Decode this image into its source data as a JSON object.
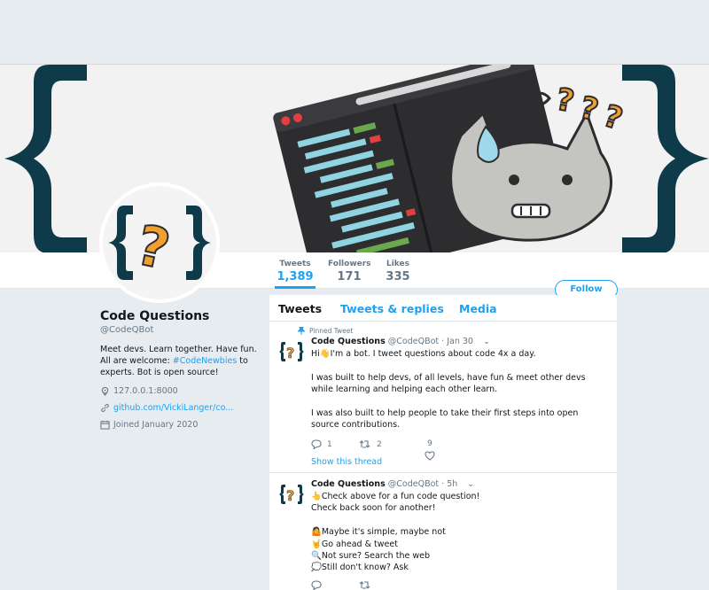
{
  "profile": {
    "name": "Code Questions",
    "handle": "@CodeQBot",
    "bio_prefix": "Meet devs. Learn together. Have fun. All are welcome: ",
    "bio_tag": "#CodeNewbies",
    "bio_suffix": " to experts. Bot is open source!",
    "location": "127.0.0.1:8000",
    "website": "github.com/VickiLanger/co...",
    "joined": "Joined January 2020"
  },
  "stats": [
    {
      "label": "Tweets",
      "value": "1,389"
    },
    {
      "label": "Followers",
      "value": "171"
    },
    {
      "label": "Likes",
      "value": "335"
    }
  ],
  "follow_label": "Follow",
  "tabs": [
    "Tweets",
    "Tweets & replies",
    "Media"
  ],
  "tweets": [
    {
      "pinned_label": "Pinned Tweet",
      "name": "Code Questions",
      "handle": "@CodeQBot",
      "time": "· Jan 30",
      "body": "Hi👋I'm a bot. I tweet questions about code 4x a day.\n\nI was built to help devs, of all levels, have fun & meet other devs while learning and helping each other learn.\n\nI was also built to help people to take their first steps into open source contributions.",
      "replies": "1",
      "retweets": "2",
      "likes": "9",
      "show_thread": "Show this thread"
    },
    {
      "name": "Code Questions",
      "handle": "@CodeQBot",
      "time": "· 5h",
      "body": "👆Check above for a fun code question!\nCheck back soon for another!\n\n🤷Maybe it's simple, maybe not\n🤘Go ahead & tweet\n🔍Not sure? Search the web\n💭Still don't know? Ask"
    }
  ],
  "colors": {
    "accent": "#1da1f2",
    "brace": "#0e3a4a",
    "question_mark": "#f0a030",
    "background": "#e6ecf0"
  }
}
